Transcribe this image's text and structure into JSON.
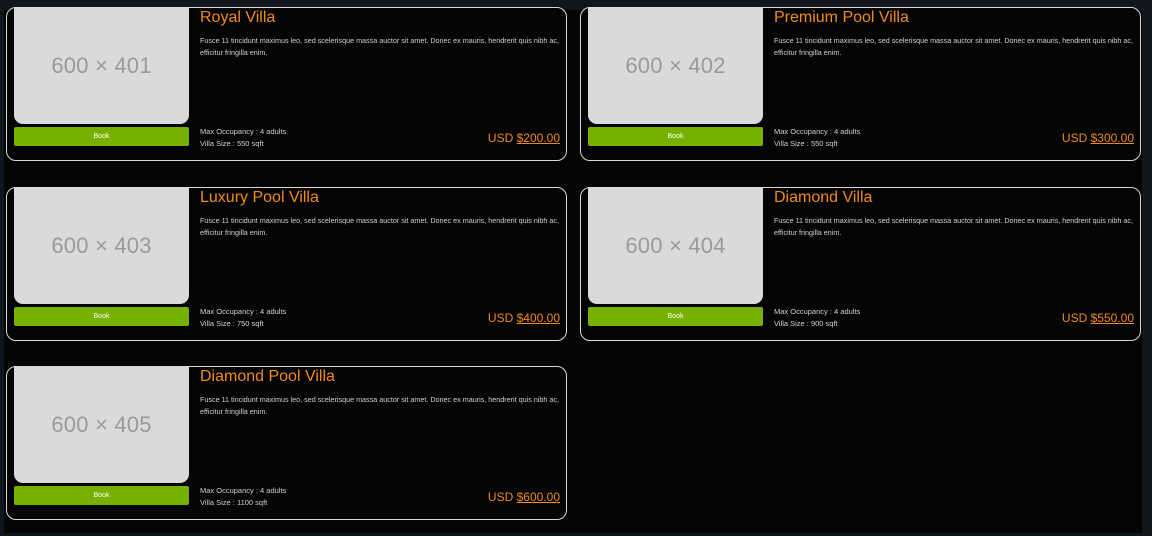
{
  "villas": [
    {
      "title": "Royal Villa",
      "image_label": "600 × 401",
      "button_label": "Book",
      "description": "Fusce 11 tincidunt maximus leo, sed scelerisque massa auctor sit amet. Donec ex mauris, hendrerit quis nibh ac, efficitur fringilla enim.",
      "occupancy": "Max Occupancy : 4 adults",
      "size": "Villa Size : 550 sqft",
      "currency": "USD",
      "amount": "$200.00"
    },
    {
      "title": "Premium Pool Villa",
      "image_label": "600 × 402",
      "button_label": "Book",
      "description": "Fusce 11 tincidunt maximus leo, sed scelerisque massa auctor sit amet. Donec ex mauris, hendrerit quis nibh ac, efficitur fringilla enim.",
      "occupancy": "Max Occupancy : 4 adults",
      "size": "Villa Size : 550 sqft",
      "currency": "USD",
      "amount": "$300.00"
    },
    {
      "title": "Luxury Pool Villa",
      "image_label": "600 × 403",
      "button_label": "Book",
      "description": "Fusce 11 tincidunt maximus leo, sed scelerisque massa auctor sit amet. Donec ex mauris, hendrerit quis nibh ac, efficitur fringilla enim.",
      "occupancy": "Max Occupancy : 4 adults",
      "size": "Villa Size : 750 sqft",
      "currency": "USD",
      "amount": "$400.00"
    },
    {
      "title": "Diamond Villa",
      "image_label": "600 × 404",
      "button_label": "Book",
      "description": "Fusce 11 tincidunt maximus leo, sed scelerisque massa auctor sit amet. Donec ex mauris, hendrerit quis nibh ac, efficitur fringilla enim.",
      "occupancy": "Max Occupancy : 4 adults",
      "size": "Villa Size : 900 sqft",
      "currency": "USD",
      "amount": "$550.00"
    },
    {
      "title": "Diamond Pool Villa",
      "image_label": "600 × 405",
      "button_label": "Book",
      "description": "Fusce 11 tincidunt maximus leo, sed scelerisque massa auctor sit amet. Donec ex mauris, hendrerit quis nibh ac, efficitur fringilla enim.",
      "occupancy": "Max Occupancy : 4 adults",
      "size": "Villa Size : 1100 sqft",
      "currency": "USD",
      "amount": "$600.00"
    }
  ],
  "colors": {
    "accent": "#f08a1c",
    "button": "#78b000",
    "background": "#050505",
    "outer_background": "#11151c"
  }
}
